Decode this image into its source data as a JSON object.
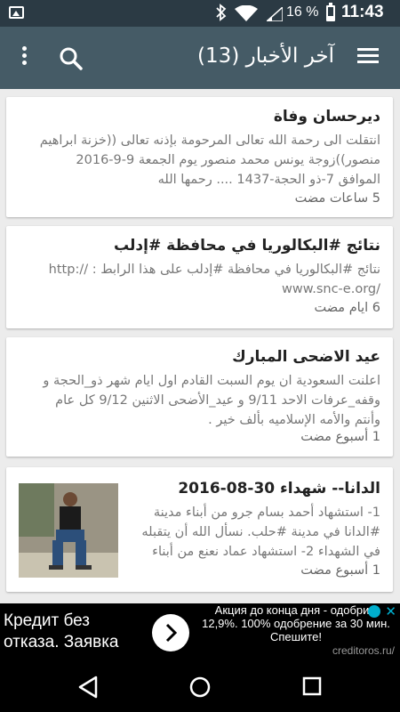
{
  "status_bar": {
    "battery_percent": "16 %",
    "time": "11:43",
    "icons": [
      "gallery-icon",
      "bluetooth-icon",
      "wifi-icon",
      "signal-icon",
      "battery-icon"
    ]
  },
  "app_bar": {
    "title": "آخر الأخبار (13)",
    "icons": [
      "menu-icon",
      "search-icon",
      "more-vert-icon"
    ],
    "color": "#455b66"
  },
  "news": [
    {
      "title": "ديرحسان  وفاة",
      "body_lines": [
        "انتقلت الى رحمة الله تعالى المرحومة بإذنه تعالى ((خزنة ابراهيم",
        "منصور))زوجة يونس محمد منصور يوم الجمعة 9-9-2016",
        "الموافق 7-ذو الحجة-1437 .... رحمها الله"
      ],
      "time": "5 ساعات مضت"
    },
    {
      "title": "نتائج #البكالوريا  في محافظة #إدلب",
      "body_lines": [
        "نتائج #البكالوريا في محافظة #إدلب على هذا الرابط : //:http",
        "/www.snc-e.org"
      ],
      "time": "6 ايام مضت"
    },
    {
      "title": "عيد الاضحى المبارك",
      "body_lines": [
        "اعلنت السعودية ان يوم السبت القادم اول ايام شهر ذو_الحجة و",
        "وقفه_عرفات الاحد 9/11 و عيد_الأضحى الاثنين 9/12 كل عام",
        "وأنتم والأمه الإسلاميه بألف خير ."
      ],
      "time": "1 أسبوع مضت"
    },
    {
      "title": "الدانا-- شهداء 30-08-2016",
      "body_lines": [
        "1- استشهاد أحمد بسام جرو من أبناء مدينة",
        "#الدانا في مدينة #حلب. نسأل الله أن يتقبله",
        "في الشهداء 2- استشهاد عماد نعنع من أبناء"
      ],
      "time": "1 أسبوع مضت",
      "has_thumbnail": true
    }
  ],
  "ad": {
    "left_text": [
      "Кредит без",
      "отказа. Заявка"
    ],
    "right_text": [
      "Акция до конца дня - одобрим",
      "12,9%. 100% одобрение за 30 мин.",
      "Спешите!"
    ],
    "domain": "creditoros.ru/",
    "icons": [
      "chevron-right-icon",
      "info-icon",
      "close-icon"
    ]
  },
  "nav_bar": {
    "icons": [
      "back-icon",
      "home-icon",
      "recents-icon"
    ]
  }
}
